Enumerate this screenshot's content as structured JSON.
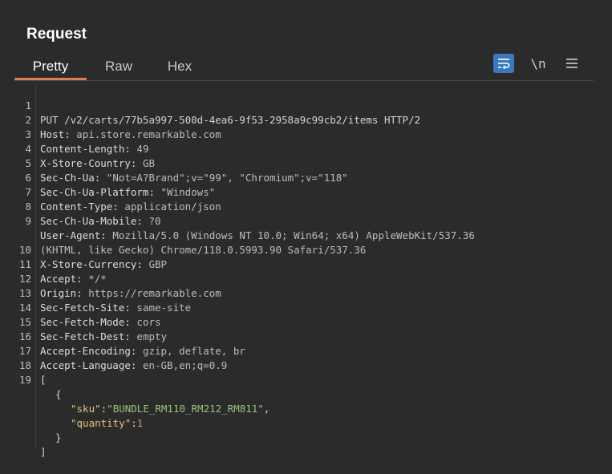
{
  "panel": {
    "title": "Request"
  },
  "tabs": [
    {
      "label": "Pretty",
      "active": true
    },
    {
      "label": "Raw",
      "active": false
    },
    {
      "label": "Hex",
      "active": false
    }
  ],
  "toolbar": {
    "wrap_icon": "wrap-lines-icon",
    "newline_label": "\\n",
    "menu_icon": "hamburger-menu-icon"
  },
  "request": {
    "request_line": "PUT /v2/carts/77b5a997-500d-4ea6-9f53-2958a9c99cb2/items HTTP/2",
    "headers": [
      {
        "name": "Host:",
        "value": "api.store.remarkable.com"
      },
      {
        "name": "Content-Length:",
        "value": "49"
      },
      {
        "name": "X-Store-Country:",
        "value": "GB"
      },
      {
        "name": "Sec-Ch-Ua:",
        "value": "\"Not=A?Brand\";v=\"99\", \"Chromium\";v=\"118\""
      },
      {
        "name": "Sec-Ch-Ua-Platform:",
        "value": "\"Windows\""
      },
      {
        "name": "Content-Type:",
        "value": "application/json"
      },
      {
        "name": "Sec-Ch-Ua-Mobile:",
        "value": "?0"
      },
      {
        "name": "User-Agent:",
        "value": "Mozilla/5.0 (Windows NT 10.0; Win64; x64) AppleWebKit/537.36"
      },
      {
        "name": "",
        "value": "(KHTML, like Gecko) Chrome/118.0.5993.90 Safari/537.36"
      },
      {
        "name": "X-Store-Currency:",
        "value": "GBP"
      },
      {
        "name": "Accept:",
        "value": "*/*"
      },
      {
        "name": "Origin:",
        "value": "https://remarkable.com"
      },
      {
        "name": "Sec-Fetch-Site:",
        "value": "same-site"
      },
      {
        "name": "Sec-Fetch-Mode:",
        "value": "cors"
      },
      {
        "name": "Sec-Fetch-Dest:",
        "value": "empty"
      },
      {
        "name": "Accept-Encoding:",
        "value": "gzip, deflate, br"
      },
      {
        "name": "Accept-Language:",
        "value": "en-GB,en;q=0.9"
      }
    ],
    "line_numbers": [
      "1",
      "2",
      "3",
      "4",
      "5",
      "6",
      "7",
      "8",
      "9",
      "",
      "10",
      "11",
      "12",
      "13",
      "14",
      "15",
      "16",
      "17",
      "18",
      "19"
    ],
    "body": {
      "open_array": "[",
      "open_object": "{",
      "sku_key": "\"sku\"",
      "sku_value": "\"BUNDLE_RM110_RM212_RM811\"",
      "quantity_key": "\"quantity\"",
      "quantity_value": "1",
      "close_object": "}",
      "close_array": "]"
    }
  }
}
